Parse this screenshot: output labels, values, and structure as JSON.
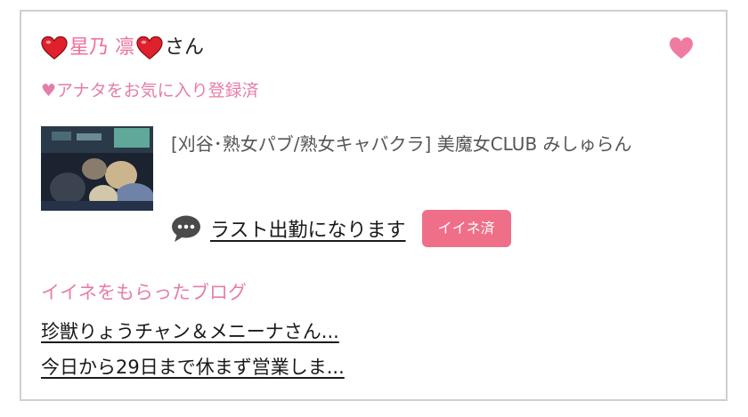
{
  "cast": {
    "name": "星乃 凛",
    "honorific": "さん",
    "name_icon": "red-heart-icon",
    "favorite_icon": "pink-heart-icon"
  },
  "favorite_status": "♥アナタをお気に入り登録済",
  "shop": {
    "thumbnail_alt": "shop-photo",
    "name": "[刈谷･熟女パブ/熟女キャバクラ]  美魔女CLUB みしゅらん"
  },
  "status": {
    "icon": "speech-bubble-icon",
    "text": "ラスト出勤になります",
    "badge": "イイネ済"
  },
  "blogs": {
    "heading": "イイネをもらったブログ",
    "items": [
      {
        "title": "珍獣りょうチャン＆メニーナさん..."
      },
      {
        "title": "今日から29日まで休まず営業しま..."
      }
    ]
  },
  "colors": {
    "pink_text": "#e57dab",
    "badge_bg": "#ef6f89",
    "heart_red": "#e0202c",
    "heart_pink": "#f07ba0"
  }
}
